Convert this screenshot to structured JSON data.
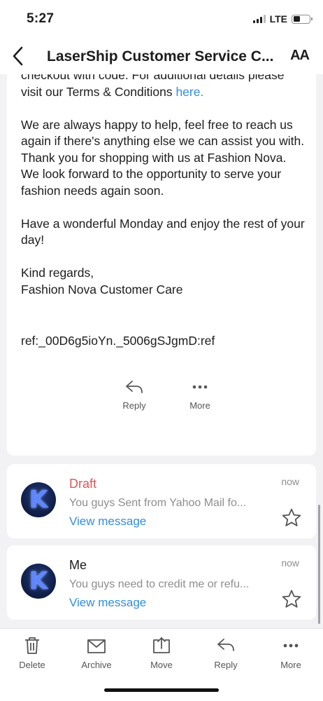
{
  "status_bar": {
    "time": "5:27",
    "network": "LTE"
  },
  "nav": {
    "title": "LaserShip Customer Service C...",
    "text_size_label": "AA"
  },
  "email_body": {
    "line_top_partial": "checkout with code. For additional details please",
    "line_terms_prefix": "visit our Terms & Conditions ",
    "terms_link": "here.",
    "paragraph_help": "We are always happy to help, feel free to reach us again if there's anything else we can assist you with. Thank you for shopping with us at Fashion Nova. We look forward to the opportunity to serve your fashion needs again soon.",
    "paragraph_wish": "Have a wonderful Monday and enjoy the rest of your day!",
    "closing": "Kind regards,",
    "signature": "Fashion Nova Customer Care",
    "ref": "ref:_00D6g5ioYn._5006gSJgmD:ref"
  },
  "card_actions": {
    "reply_label": "Reply",
    "more_label": "More"
  },
  "messages": [
    {
      "avatar_letter": "K",
      "sender": "Draft",
      "snippet": "You guys  Sent from Yahoo Mail fo...",
      "link": "View message",
      "time": "now",
      "sender_color": "#e05555"
    },
    {
      "avatar_letter": "K",
      "sender": "Me",
      "snippet": "You guys need to credit me or refu...",
      "link": "View message",
      "time": "now",
      "sender_color": "#1d1d1f"
    }
  ],
  "toolbar": {
    "delete_label": "Delete",
    "archive_label": "Archive",
    "move_label": "Move",
    "reply_label": "Reply",
    "more_label": "More"
  },
  "colors": {
    "accent": "#2f8de4",
    "draft": "#e05555",
    "background": "#f2f2f4"
  }
}
